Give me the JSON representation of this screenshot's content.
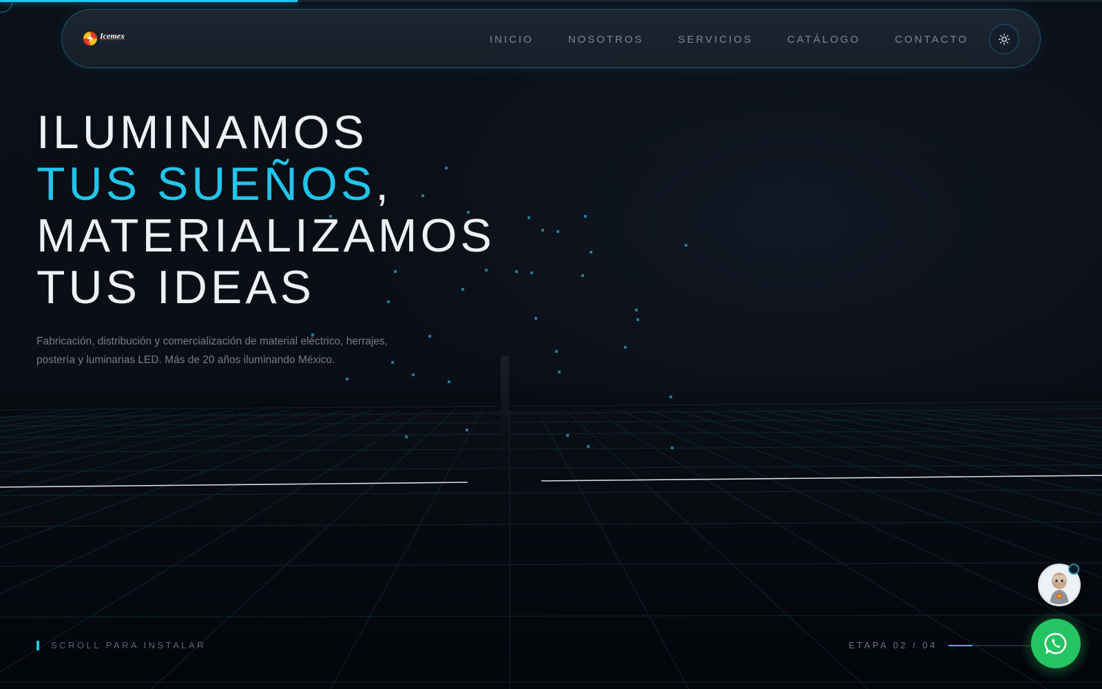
{
  "brand": {
    "name": "Icemex",
    "logo_icon": "lightning-bolt-logo-icon",
    "accent_color": "#22c4ea"
  },
  "nav": {
    "items": [
      {
        "label": "INICIO"
      },
      {
        "label": "NOSOTROS"
      },
      {
        "label": "SERVICIOS"
      },
      {
        "label": "CATÁLOGO"
      },
      {
        "label": "CONTACTO"
      }
    ],
    "theme_toggle_icon": "sun-icon"
  },
  "page_progress": 0.27,
  "hero": {
    "title_line1": "ILUMINAMOS",
    "title_line2_accent": "TUS SUEÑOS",
    "title_line2_rest": ",",
    "title_line3": "MATERIALIZAMOS",
    "title_line4": "TUS IDEAS",
    "subtitle": "Fabricación, distribución y comercialización de material eléctrico, herrajes, postería y luminarias LED. Más de 20 años iluminando México."
  },
  "footer": {
    "scroll_hint": "SCROLL PARA INSTALAR",
    "stage_label": "ETAPA 02 / 04",
    "stage_progress": 0.25
  },
  "floating": {
    "assistant_icon": "robot-assistant-avatar-icon",
    "whatsapp_icon": "whatsapp-icon",
    "whatsapp_color": "#25c462"
  }
}
